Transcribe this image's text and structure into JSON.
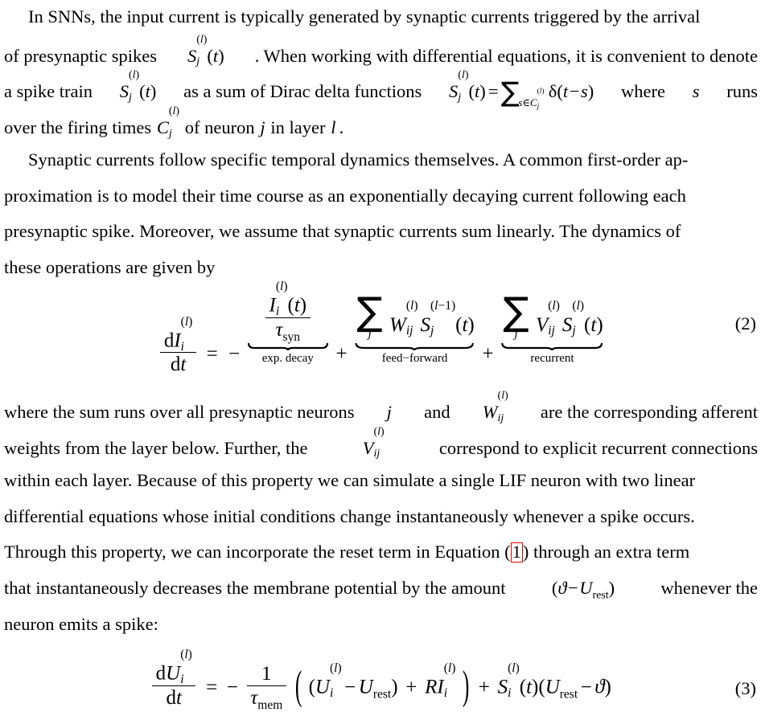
{
  "document": {
    "type": "academic-paper-body",
    "background_color": "#ffffff",
    "text_color": "#000000",
    "link_box_color": "#e00000"
  },
  "paragraph1": {
    "lines": [
      "In SNNs, the input current is typically generated by synaptic currents triggered by the arrival",
      "of presynaptic spikes S_j^(l)(t). When working with differential equations, it is convenient to denote",
      "a spike train S_j^(l)(t) as a sum of Dirac delta functions S_j^(l)(t) = ∑_{s∈C_j^(l)} δ(t − s) where s runs",
      "over the firing times C_j^(l) of neuron j in layer l."
    ],
    "l1_a": "In SNNs, the input current is typically generated by synaptic currents triggered by the arrival",
    "l2_a": "of presynaptic spikes",
    "l2_b": ". When working with differential equations, it is convenient to denote",
    "l3_a": "a spike train",
    "l3_b": "as a sum of Dirac delta functions",
    "l3_c": "where",
    "l3_d": "runs",
    "l4_a": "over the firing times",
    "l4_b": "of neuron",
    "l4_c": "in layer",
    "l4_d": "."
  },
  "paragraph2": {
    "l1": "Synaptic currents follow specific temporal dynamics themselves. A common first-order ap-",
    "l2": "proximation is to model their time course as an exponentially decaying current following each",
    "l3": "presynaptic spike. Moreover, we assume that synaptic currents sum linearly. The dynamics of",
    "l4": "these operations are given by"
  },
  "equation2": {
    "number": "(2)",
    "lhs_numerator": "dI",
    "lhs_denominator": "dt",
    "tau_syn": "τ",
    "tau_syn_sub": "syn",
    "label_exp_decay": "exp. decay",
    "label_feed_forward": "feed−forward",
    "label_recurrent": "recurrent",
    "W_symbol": "W",
    "V_symbol": "V",
    "S_symbol": "S",
    "I_symbol": "I",
    "sum_symbol": "∑",
    "sum_index": "j",
    "superscript_l": "(l)",
    "superscript_l_minus_1": "(l−1)",
    "subscript_i": "i",
    "subscript_ij": "ij",
    "subscript_j": "j",
    "time_arg": "(t)",
    "equals": "=",
    "minus": "−",
    "plus": "+"
  },
  "paragraph3": {
    "l1_a": "where the sum runs over all presynaptic neurons",
    "l1_b": "and",
    "l1_c": "are the corresponding afferent",
    "l2_a": "weights from the layer below. Further, the",
    "l2_b": "correspond to explicit recurrent connections",
    "l3": "within each layer. Because of this property we can simulate a single LIF neuron with two linear",
    "l4": "differential equations whose initial conditions change instantaneously whenever a spike occurs.",
    "l5_a": "Through this property, we can incorporate the reset term in Equation (",
    "l5_ref": "1",
    "l5_b": ") through an extra term",
    "l6_a": "that instantaneously decreases the membrane potential by the amount",
    "l6_b": "whenever the",
    "l7": "neuron emits a spike:"
  },
  "equation3": {
    "number": "(3)",
    "lhs_numerator": "dU",
    "lhs_denominator": "dt",
    "one": "1",
    "tau_mem": "τ",
    "tau_mem_sub": "mem",
    "U_symbol": "U",
    "U_rest_sub": "rest",
    "R_symbol": "R",
    "I_symbol": "I",
    "S_symbol": "S",
    "theta": "ϑ",
    "superscript_l": "(l)",
    "subscript_i": "i",
    "time_arg": "(t)",
    "equals": "=",
    "minus": "−",
    "plus": "+"
  },
  "inline_math": {
    "S_j_l_t": "S_j^(l)(t)",
    "C_j_l": "C_j^(l)",
    "W_ij_l": "W_ij^(l)",
    "V_ij_l": "V_ij^(l)",
    "j": "j",
    "l": "l",
    "s": "s",
    "delta": "δ",
    "theta_minus_urest": "(ϑ − U_rest)"
  }
}
